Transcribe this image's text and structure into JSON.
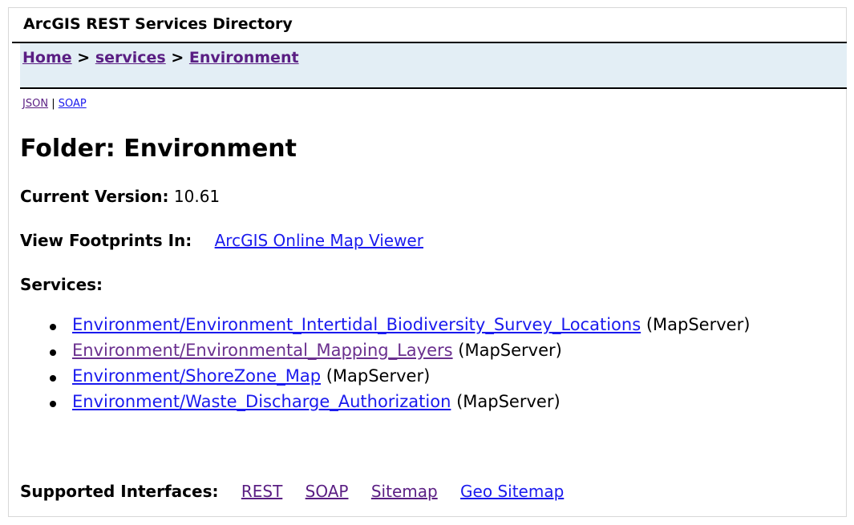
{
  "header": {
    "title": "ArcGIS REST Services Directory"
  },
  "breadcrumb": {
    "items": [
      "Home",
      "services",
      "Environment"
    ],
    "separator": ">"
  },
  "formats": {
    "json": "JSON",
    "separator": "|",
    "soap": "SOAP"
  },
  "folder": {
    "heading": "Folder: Environment"
  },
  "version": {
    "label": "Current Version:",
    "value": "10.61"
  },
  "footprints": {
    "label": "View Footprints In:",
    "link": "ArcGIS Online Map Viewer"
  },
  "services": {
    "label": "Services:",
    "items": [
      {
        "name": "Environment/Environment_Intertidal_Biodiversity_Survey_Locations",
        "type": "(MapServer)"
      },
      {
        "name": "Environment/Environmental_Mapping_Layers",
        "type": "(MapServer)"
      },
      {
        "name": "Environment/ShoreZone_Map",
        "type": "(MapServer)"
      },
      {
        "name": "Environment/Waste_Discharge_Authorization",
        "type": "(MapServer)"
      }
    ]
  },
  "interfaces": {
    "label": "Supported Interfaces:",
    "items": [
      "REST",
      "SOAP",
      "Sitemap",
      "Geo Sitemap"
    ]
  },
  "colors": {
    "link": "#1a1aee",
    "visited_link": "#5a1e83",
    "breadcrumb_bg": "#e3eef5"
  }
}
